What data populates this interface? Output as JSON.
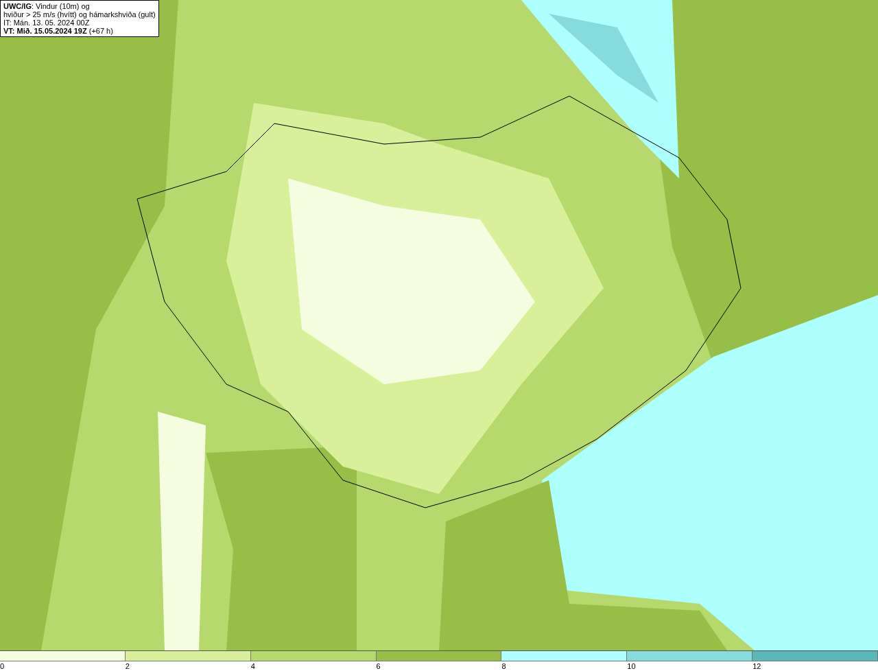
{
  "info_box": {
    "lines": [
      "**UWC/IG**: Vindur (10m) og",
      "hviður > 25 m/s (hvítt) og hámarkshviða (gult)",
      "IT: Mán. 13. 05. 2024 00Z",
      "**VT: Mið. 15.05.2024 19Z** (+67 h)"
    ]
  },
  "legend": {
    "bins": [
      {
        "color": "#f5fde0"
      },
      {
        "color": "#d8f09a"
      },
      {
        "color": "#b5d96c"
      },
      {
        "color": "#97bf47"
      },
      {
        "color": "#aeffff"
      },
      {
        "color": "#86dcdc"
      },
      {
        "color": "#5ab8b8"
      }
    ],
    "ticks": [
      "0",
      "2",
      "4",
      "6",
      "8",
      "10",
      "12"
    ]
  }
}
